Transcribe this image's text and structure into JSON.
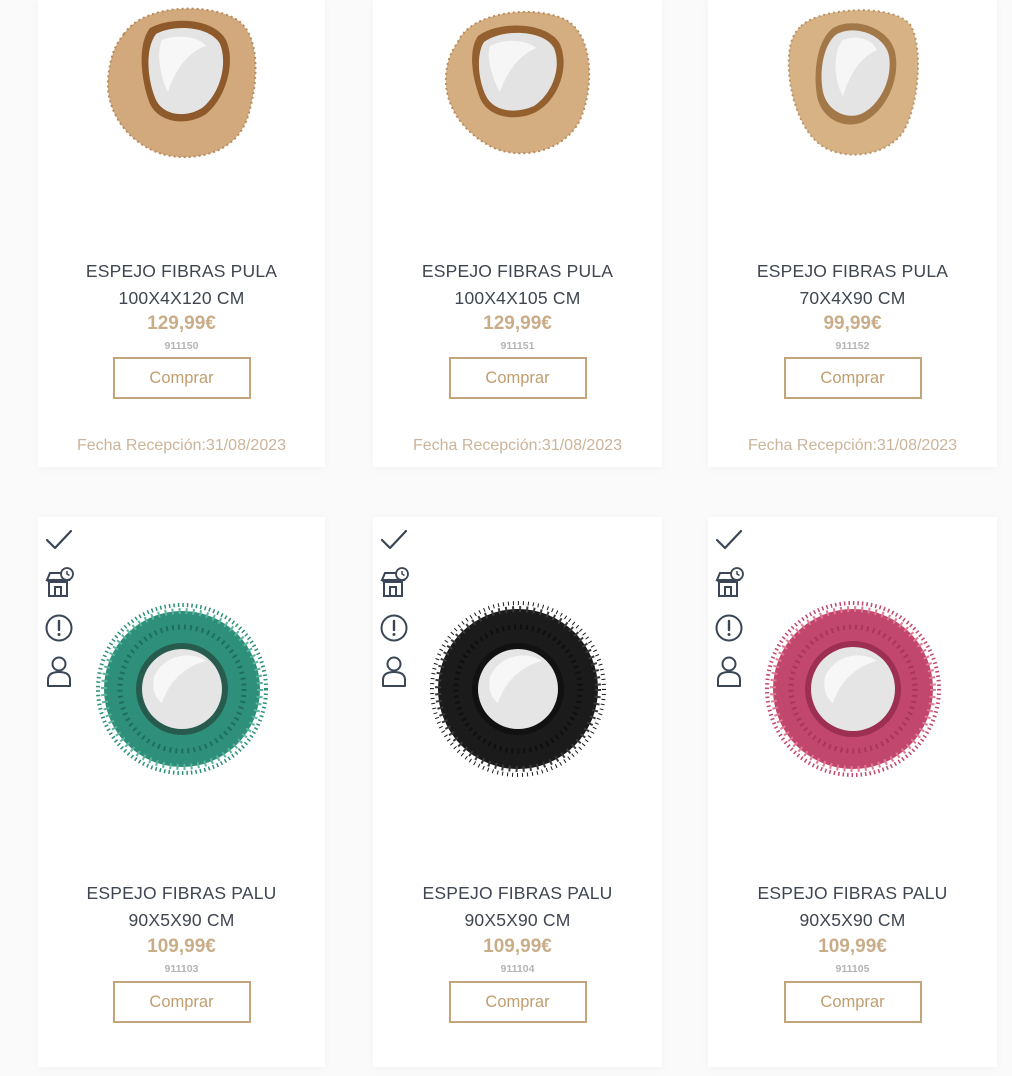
{
  "products": [
    {
      "name_line1": "ESPEJO FIBRAS PULA",
      "name_line2": "100X4X120 CM",
      "price": "129,99€",
      "ref": "911150",
      "buy_label": "Comprar",
      "reception": "Fecha Recepción:31/08/2023",
      "fiber_color": "#d1a97c",
      "shape": "organic"
    },
    {
      "name_line1": "ESPEJO FIBRAS PULA",
      "name_line2": "100X4X105 CM",
      "price": "129,99€",
      "ref": "911151",
      "buy_label": "Comprar",
      "reception": "Fecha Recepción:31/08/2023",
      "fiber_color": "#d4ad80",
      "shape": "organic"
    },
    {
      "name_line1": "ESPEJO FIBRAS PULA",
      "name_line2": "70X4X90 CM",
      "price": "99,99€",
      "ref": "911152",
      "buy_label": "Comprar",
      "reception": "Fecha Recepción:31/08/2023",
      "fiber_color": "#d6b285",
      "shape": "organic"
    },
    {
      "name_line1": "ESPEJO FIBRAS PALU",
      "name_line2": "90X5X90 CM",
      "price": "109,99€",
      "ref": "911103",
      "buy_label": "Comprar",
      "fiber_color": "#2e8f7a",
      "shape": "round"
    },
    {
      "name_line1": "ESPEJO FIBRAS PALU",
      "name_line2": "90X5X90 CM",
      "price": "109,99€",
      "ref": "911104",
      "buy_label": "Comprar",
      "fiber_color": "#1b1b1b",
      "shape": "round"
    },
    {
      "name_line1": "ESPEJO FIBRAS PALU",
      "name_line2": "90X5X90 CM",
      "price": "109,99€",
      "ref": "911105",
      "buy_label": "Comprar",
      "fiber_color": "#c2476e",
      "shape": "round"
    }
  ],
  "status_icons": [
    "check-icon",
    "store-clock-icon",
    "alert-circle-icon",
    "user-icon"
  ],
  "colors": {
    "accent": "#c4a47a",
    "price": "#c9ad89",
    "title": "#3f4651",
    "icon": "#3a4656"
  }
}
